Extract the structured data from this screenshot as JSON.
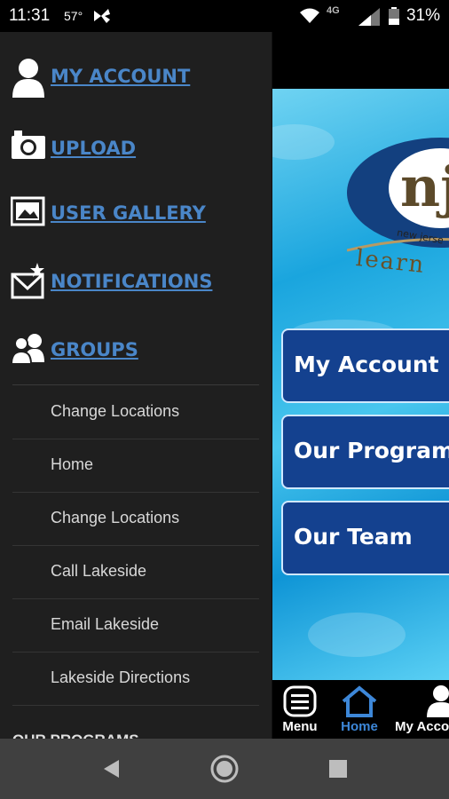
{
  "status_bar": {
    "time": "11:31",
    "temperature": "57°",
    "network": "4G",
    "battery": "31%"
  },
  "drawer": {
    "nav_items": [
      {
        "label": "MY ACCOUNT",
        "icon": "person-icon"
      },
      {
        "label": "UPLOAD",
        "icon": "camera-icon"
      },
      {
        "label": "USER GALLERY",
        "icon": "gallery-icon"
      },
      {
        "label": "NOTIFICATIONS",
        "icon": "envelope-star-icon"
      },
      {
        "label": "GROUPS",
        "icon": "group-icon"
      }
    ],
    "sub_items": [
      "Change Locations",
      "Home",
      "Change Locations",
      "Call Lakeside",
      "Email Lakeside",
      "Lakeside Directions"
    ],
    "section_header": "OUR PROGRAMS"
  },
  "main": {
    "logo": {
      "text": "nj",
      "subtext": "new jerse",
      "tagline": "learn"
    },
    "buttons": [
      "My Account",
      "Our Programs",
      "Our Team"
    ]
  },
  "tab_bar": {
    "tabs": [
      {
        "label": "Menu",
        "icon": "menu-icon",
        "color": "#ffffff"
      },
      {
        "label": "Home",
        "icon": "home-icon",
        "color": "#3d87d8"
      },
      {
        "label": "My Acco",
        "icon": "person-icon",
        "color": "#ffffff"
      }
    ]
  },
  "colors": {
    "link_blue": "#4a86c8",
    "button_blue": "#14418f",
    "drawer_bg": "#1f1f1f"
  }
}
